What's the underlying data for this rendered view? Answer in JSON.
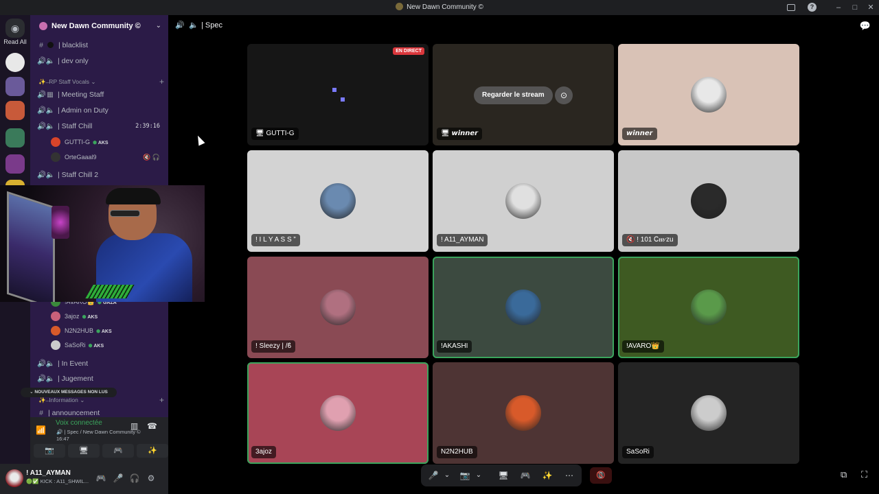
{
  "window": {
    "title": "New Dawn Community ©",
    "controls": [
      "–",
      "□",
      "✕"
    ]
  },
  "rail": {
    "read_all": "Read All",
    "colors": {
      "servers": [
        "#e8e8e8",
        "#6a5a9a",
        "#c85a3a",
        "#3a7a5a",
        "#d8b030",
        "#7a3a8a"
      ]
    }
  },
  "server": {
    "name": "New Dawn Community ©"
  },
  "channels": {
    "blacklist": "| blacklist",
    "dev_only": "| dev only",
    "category_staff": "✨ ̶ RP Staff Vocals ⌄",
    "meeting_staff": "| Meeting Staff",
    "admin_on_duty": "| Admin on Duty",
    "staff_chill": "| Staff Chill",
    "staff_chill_timer": "2:39:16",
    "staff_chill_2": "| Staff Chill 2",
    "in_event": "| In Event",
    "jugement": "| Jugement",
    "category_info": "✨ ̶ Information ⌄",
    "announcement": "| announcement"
  },
  "voice_users_top": [
    {
      "name": "GUTTI-G",
      "tag": "AKS",
      "color": "#d8442a"
    },
    {
      "name": "OrteGaaal9",
      "tag": "",
      "color": "#333333"
    }
  ],
  "voice_users_bottom": [
    {
      "name": "!AVARO👑",
      "tag": "GAZA",
      "color": "#3a8a3a"
    },
    {
      "name": "3ajoz",
      "tag": "AKS",
      "color": "#c8607a"
    },
    {
      "name": "N2N2HUB",
      "tag": "AKS",
      "color": "#d85a2a"
    },
    {
      "name": "SaSoRi",
      "tag": "AKS",
      "color": "#cccccc"
    }
  ],
  "unread_pill": "⌄ NOUVEAUX MESSAGES NON LUS",
  "voice_panel": {
    "status": "Voix connectée",
    "channel": "🔊 | Spec / New Dawn Community ©",
    "time": "16:47"
  },
  "user": {
    "name": "! A11_AYMAN",
    "status": "🟢✅ KICK : A11_SHWIL..."
  },
  "main": {
    "channel_title": "| Spec"
  },
  "tiles": [
    {
      "name": "GUTTI-G",
      "prefix": "🖥",
      "live": "EN DIRECT",
      "bg": "#161616",
      "avatar": ""
    },
    {
      "name": "𝙬𝙞𝙣𝙣𝙚𝙧",
      "prefix": "🖥",
      "watch": "Regarder le stream",
      "bg": "#2a2620",
      "avatar": ""
    },
    {
      "name": "𝙬𝙞𝙣𝙣𝙚𝙧",
      "prefix": "",
      "bg": "#d9c2b6",
      "avatar": "#e8e8e8"
    },
    {
      "name": "! I L Y A S S ”",
      "prefix": "",
      "bg": "#d3d3d3",
      "avatar": "#6a8ab0"
    },
    {
      "name": "! A11_AYMAN",
      "prefix": "",
      "bg": "#d0d0d0",
      "avatar": "#e0e0e0"
    },
    {
      "name": "! 101 Ꮯꮋꮍzu",
      "prefix": "🔇",
      "bg": "#c8c8c8",
      "avatar": "#2a2a2a"
    },
    {
      "name": "! Sleezy | /ϐ",
      "prefix": "",
      "bg": "#8a4a54",
      "avatar": "#b07080"
    },
    {
      "name": "!AKASHI",
      "prefix": "",
      "bg": "#3c4a40",
      "avatar": "#3a6a9a",
      "speaking": true
    },
    {
      "name": "!AVARO👑",
      "prefix": "",
      "bg": "#3e5a22",
      "avatar": "#5a9a4a",
      "speaking": true
    },
    {
      "name": "3ajoz",
      "prefix": "",
      "bg": "#a84556",
      "avatar": "#e0a0b0",
      "speaking": true
    },
    {
      "name": "N2N2HUB",
      "prefix": "",
      "bg": "#4e3434",
      "avatar": "#d85a2a"
    },
    {
      "name": "SaSoRi",
      "prefix": "",
      "bg": "#242424",
      "avatar": "#cccccc"
    }
  ],
  "controls": {
    "mic": "🎤",
    "mic_chevron": "⌄",
    "camera": "📷",
    "cam_chevron": "⌄",
    "share": "🖥",
    "activity": "🎮",
    "soundboard": "✨",
    "more": "⋯",
    "leave": "📵"
  }
}
